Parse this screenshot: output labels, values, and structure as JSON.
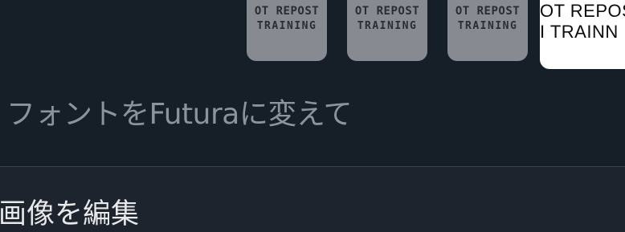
{
  "thumbnails": [
    {
      "line1": "OT REPOST",
      "line2": "TRAINING"
    },
    {
      "line1": "OT REPOST",
      "line2": "TRAINING"
    },
    {
      "line1": "OT REPOST",
      "line2": "TRAINING"
    }
  ],
  "selected_thumbnail": {
    "line1": "OT REPOS",
    "line2": "I TRAINN"
  },
  "font_hint": "フォントをFuturaに変えて",
  "edit_image_label": "画像を編集",
  "colors": {
    "background_top": "#161e27",
    "background_bottom": "#1d242e",
    "divider": "#3a434d",
    "thumbnail_gray": "#878a90",
    "thumbnail_selected": "#ffffff",
    "hint_text": "#8b939e",
    "title_text": "#e7e9ea"
  }
}
